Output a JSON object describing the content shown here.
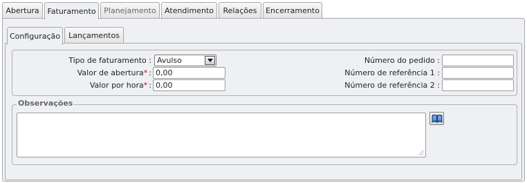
{
  "top_tabs": [
    {
      "label": "Abertura",
      "state": "normal"
    },
    {
      "label": "Faturamento",
      "state": "active"
    },
    {
      "label": "Planejamento",
      "state": "disabled"
    },
    {
      "label": "Atendimento",
      "state": "normal"
    },
    {
      "label": "Relações",
      "state": "normal"
    },
    {
      "label": "Encerramento",
      "state": "normal"
    }
  ],
  "sub_tabs": [
    {
      "label": "Configuração",
      "state": "active"
    },
    {
      "label": "Lançamentos",
      "state": "normal"
    }
  ],
  "form": {
    "tipo_label": "Tipo de faturamento",
    "tipo_value": "Avulso",
    "valor_abertura_label": "Valor de abertura",
    "valor_abertura_value": "0,00",
    "valor_hora_label": "Valor por hora",
    "valor_hora_value": "0,00",
    "numero_pedido_label": "Número do pedido",
    "numero_pedido_value": "",
    "ref1_label": "Número de referência 1",
    "ref1_value": "",
    "ref2_label": "Número de referência 2",
    "ref2_value": "",
    "required_marker": "*",
    "colon": ":"
  },
  "observacoes": {
    "legend": "Observações",
    "value": ""
  },
  "icons": {
    "dropdown_arrow": "chevron-down-icon",
    "book": "book-icon",
    "resize_grip": "resize-grip-icon"
  },
  "colors": {
    "panel_bg": "#eef0f3",
    "border": "#a8a8a8",
    "required": "#d10000"
  }
}
